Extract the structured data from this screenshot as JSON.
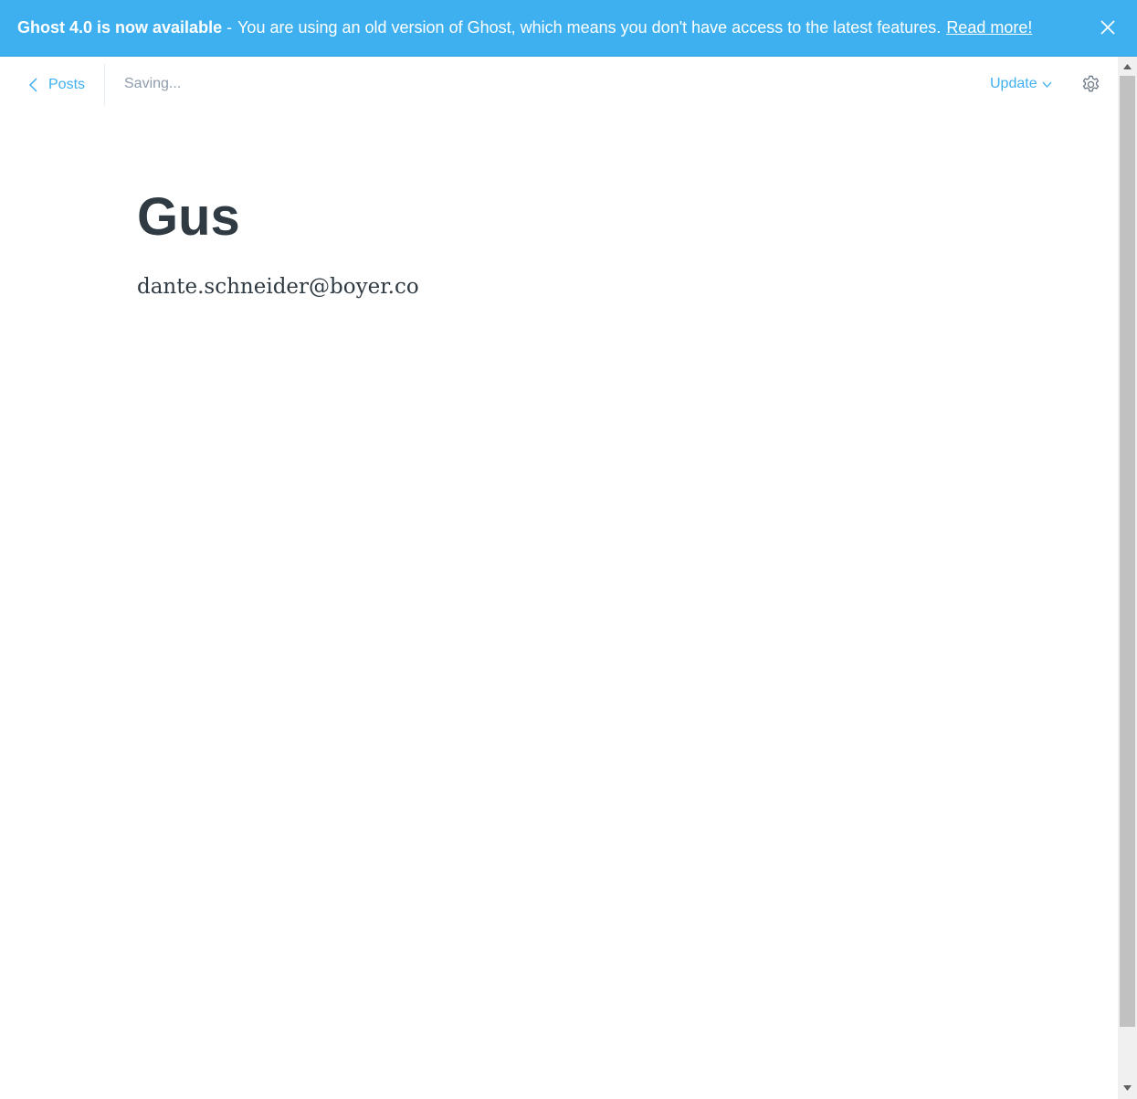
{
  "banner": {
    "headline": "Ghost 4.0 is now available",
    "separator": "-",
    "message": "You are using an old version of Ghost, which means you don't have access to the latest features.",
    "link_label": "Read more!",
    "close_icon": "close-icon",
    "background_color": "#3eb0ef"
  },
  "header": {
    "back_label": "Posts",
    "back_icon": "chevron-left-icon",
    "status_text": "Saving...",
    "update_label": "Update",
    "update_icon": "chevron-down-icon",
    "settings_icon": "gear-icon",
    "accent_color": "#3eb0ef"
  },
  "post": {
    "title": "Gus",
    "body": "dante.schneider@boyer.co"
  }
}
